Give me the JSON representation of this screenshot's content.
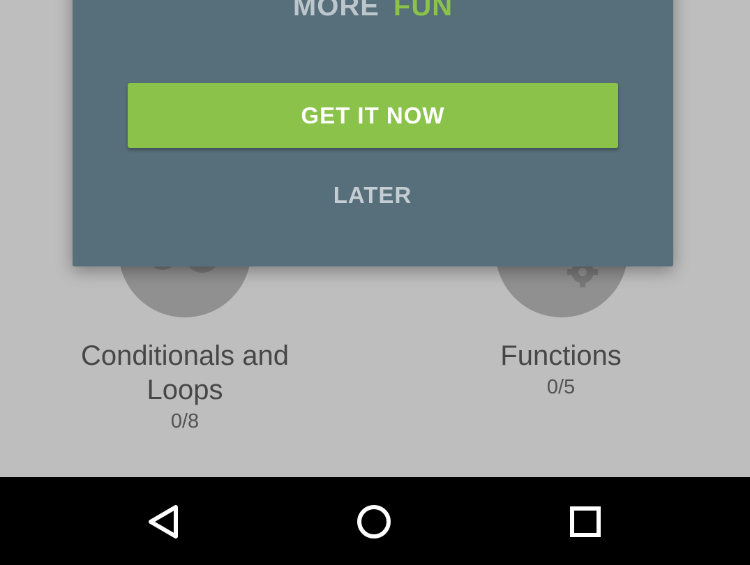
{
  "dialog": {
    "headline_part1": "MORE",
    "headline_part2": "FUN",
    "primary_button_label": "GET IT NOW",
    "secondary_button_label": "LATER"
  },
  "modules": [
    {
      "title_line1": "Conditionals and",
      "title_line2": "Loops",
      "progress": "0/8"
    },
    {
      "title_line1": "Functions",
      "title_line2": "",
      "progress": "0/5"
    }
  ],
  "navbar": {
    "back_icon": "back-triangle-icon",
    "home_icon": "home-circle-icon",
    "recents_icon": "recents-square-icon"
  },
  "colors": {
    "dialog_background": "#576e7b",
    "accent_green": "#8bc34a",
    "navbar_background": "#000000"
  }
}
